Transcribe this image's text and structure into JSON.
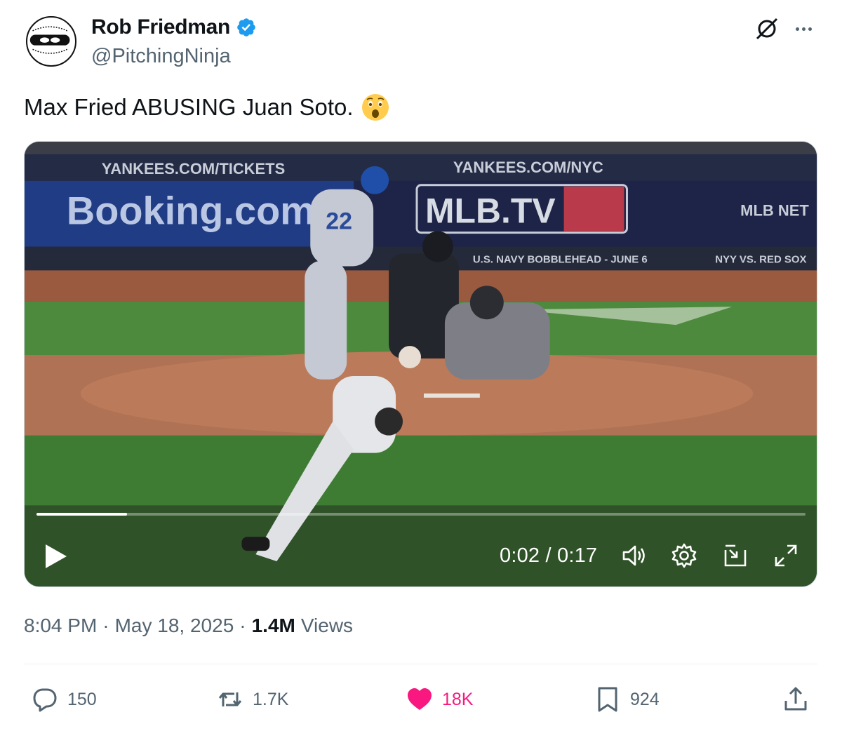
{
  "author": {
    "display_name": "Rob Friedman",
    "handle": "@PitchingNinja",
    "verified": true,
    "verified_color": "#1d9bf0"
  },
  "tweet": {
    "text": "Max Fried ABUSING Juan Soto.",
    "emoji": "astonished-face"
  },
  "video": {
    "scene_signs": {
      "top_left": "YANKEES.COM/TICKETS",
      "top_center": "YANKEES.COM/NYC",
      "booking": "Booking.com",
      "mlbtv": "MLB.TV",
      "mlb_network": "MLB NET",
      "bobblehead": "U.S. NAVY BOBBLEHEAD - JUNE 6",
      "nyy_vs": "NYY VS. RED SOX",
      "jersey_number": "22"
    },
    "current_time": "0:02",
    "duration": "0:17",
    "time_display": "0:02 / 0:17",
    "progress_fraction": 0.1176,
    "controls": [
      "play-icon",
      "volume-icon",
      "settings-icon",
      "pop-out-icon",
      "fullscreen-icon"
    ]
  },
  "meta": {
    "time": "8:04 PM",
    "separator": "·",
    "date": "May 18, 2025",
    "views_count": "1.4M",
    "views_label": "Views"
  },
  "actions": {
    "replies": "150",
    "reposts": "1.7K",
    "likes": "18K",
    "bookmarks": "924",
    "like_color": "#f91880",
    "muted_color": "#536471"
  }
}
